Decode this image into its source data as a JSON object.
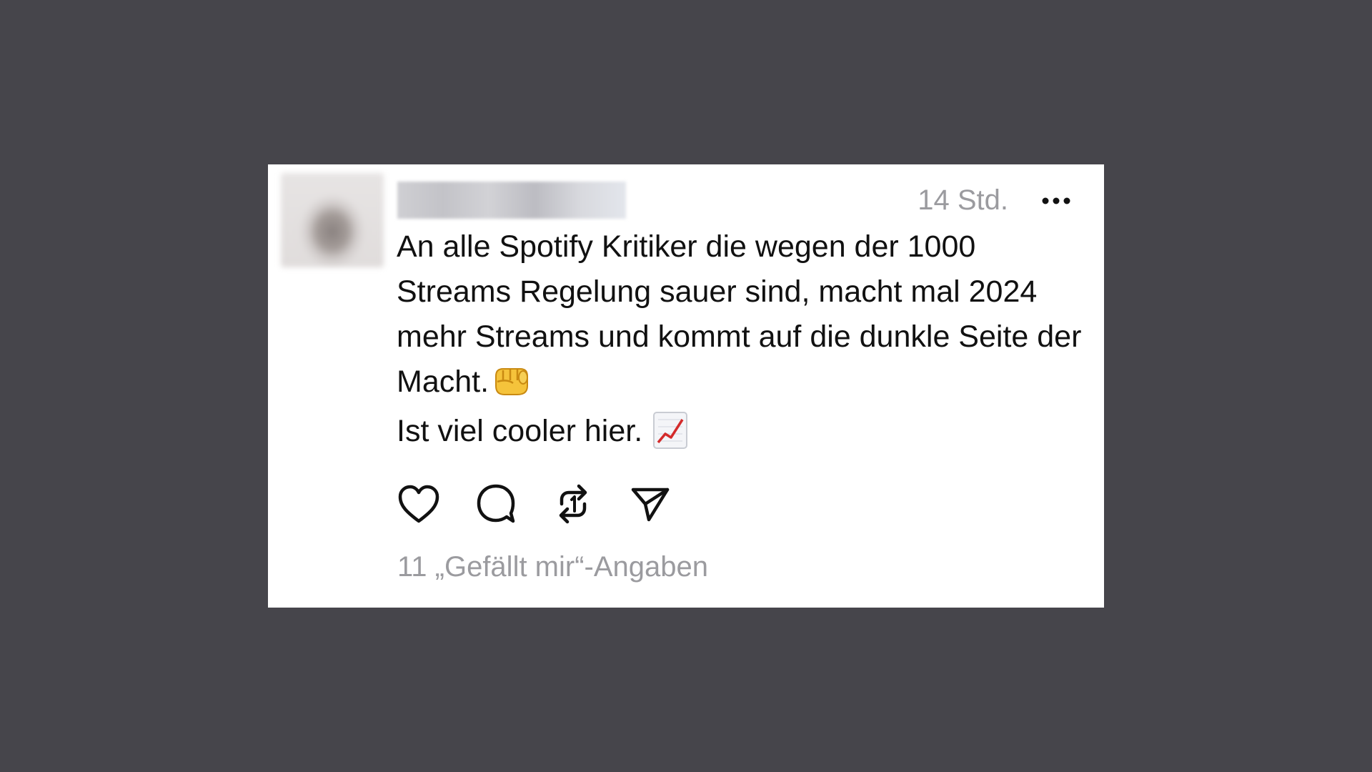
{
  "post": {
    "timestamp": "14 Std.",
    "text_line_1": "An alle Spotify Kritiker die wegen der 1000 Streams Regelung sauer sind, macht mal 2024 mehr Streams und kommt auf die dunkle Seite der Macht.",
    "text_line_2": "Ist viel cooler hier.",
    "emoji_1": "oncoming-fist-emoji",
    "emoji_2": "chart-increasing-emoji",
    "likes_label": "11 „Gefällt mir“-Angaben"
  },
  "actions": {
    "icons": [
      "heart-icon",
      "comment-icon",
      "repost-icon",
      "share-icon"
    ]
  },
  "menu": {
    "icon": "more-options-icon"
  },
  "colors": {
    "background": "#46454b",
    "card": "#ffffff",
    "text": "#111111",
    "secondary_text": "#9b9b9f",
    "chart_line": "#d42b2b"
  }
}
